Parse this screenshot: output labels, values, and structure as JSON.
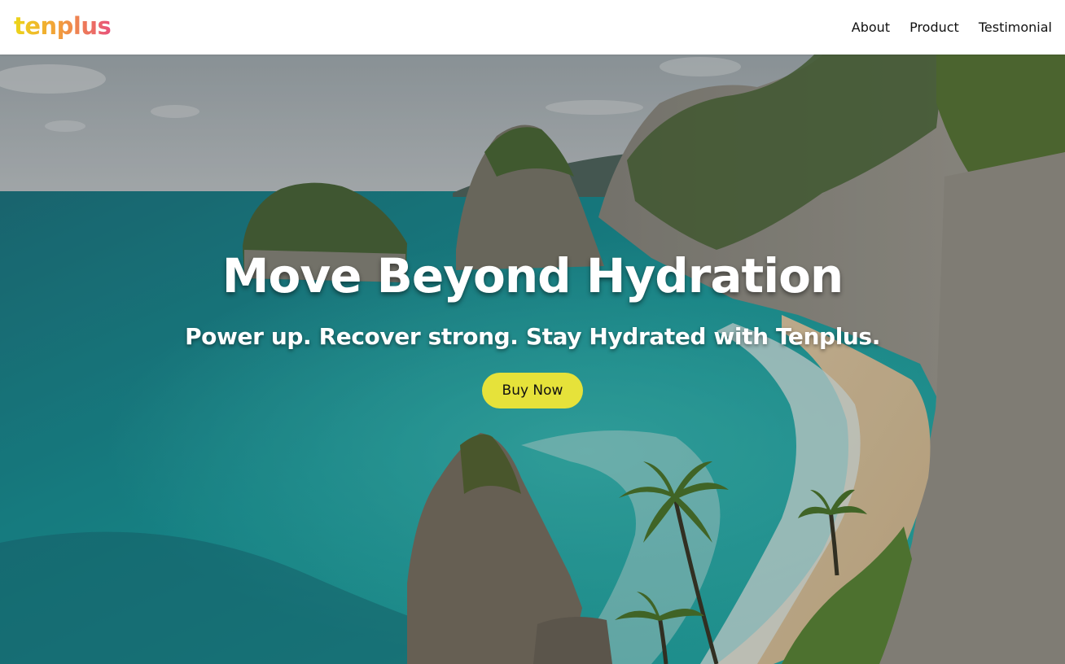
{
  "brand": {
    "logo_text": "tenplus"
  },
  "nav": {
    "items": [
      {
        "label": "About"
      },
      {
        "label": "Product"
      },
      {
        "label": "Testimonial"
      }
    ]
  },
  "hero": {
    "title": "Move Beyond Hydration",
    "subtitle": "Power up. Recover strong. Stay Hydrated with Tenplus.",
    "cta_label": "Buy Now",
    "background_image": "tropical-coastline-photo"
  },
  "colors": {
    "logo_gradient_start": "#ecd619",
    "logo_gradient_end": "#e8527a",
    "cta_background": "#e6e23a",
    "header_background": "#ffffff"
  }
}
